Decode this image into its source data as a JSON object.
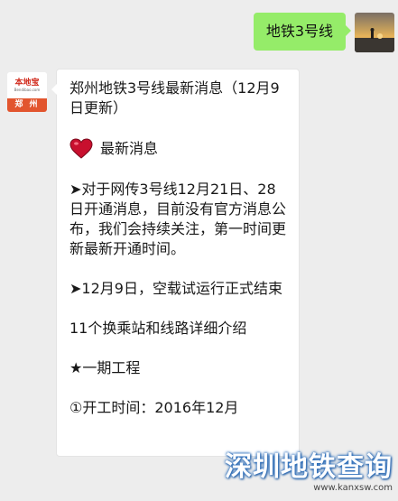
{
  "outgoing": {
    "text": "地铁3号线"
  },
  "incoming": {
    "avatar": {
      "brand": "本地宝",
      "domain": "Bendibao.com",
      "city": "郑 州"
    },
    "title": "郑州地铁3号线最新消息（12月9日更新）",
    "section_latest": "最新消息",
    "item1": "➤对于网传3号线12月21日、28日开通消息，目前没有官方消息公布，我们会持续关注，第一时间更新最新开通时间。",
    "item2": "➤12月9日，空载试运行正式结束",
    "item3": "11个换乘站和线路详细介绍",
    "item4": "★一期工程",
    "item5": "①开工时间：2016年12月"
  },
  "watermark": {
    "title": "深圳地铁查询",
    "url": "www.kanxsw.com"
  },
  "colors": {
    "bubble_out": "#95ec69",
    "bubble_in": "#ffffff",
    "background": "#ededed",
    "watermark_stroke": "#2a6ebd"
  }
}
